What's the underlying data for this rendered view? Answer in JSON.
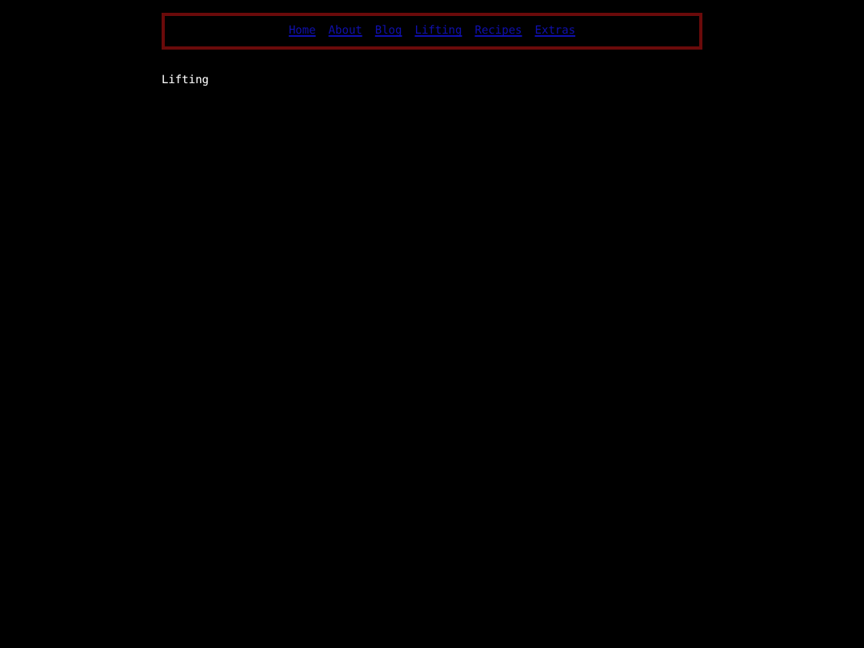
{
  "nav": {
    "links": [
      {
        "label": "Home"
      },
      {
        "label": "About"
      },
      {
        "label": "Blog"
      },
      {
        "label": "Lifting"
      },
      {
        "label": "Recipes"
      },
      {
        "label": "Extras"
      }
    ]
  },
  "heading": "Lifting"
}
